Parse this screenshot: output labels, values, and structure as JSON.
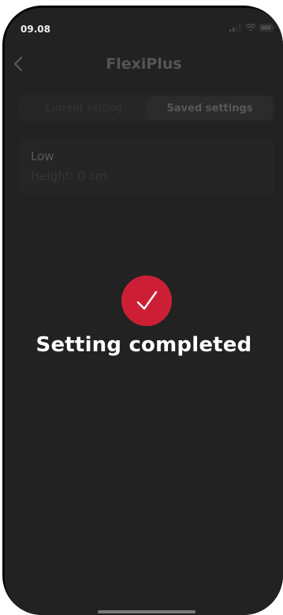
{
  "status_bar": {
    "time": "09.08",
    "icons": [
      "cellular-signal-icon",
      "wifi-icon",
      "battery-icon"
    ]
  },
  "nav": {
    "back_icon": "chevron-left-icon",
    "title": "FlexiPlus"
  },
  "tabs": [
    {
      "label": "Current setting",
      "selected": false
    },
    {
      "label": "Saved settings",
      "selected": true
    }
  ],
  "preset": {
    "name": "Low",
    "height": "Height: 0 cm"
  },
  "overlay": {
    "icon": "checkmark-icon",
    "message": "Setting completed"
  },
  "colors": {
    "accent": "#cc1f36",
    "background": "#222222",
    "overlay_text": "#ffffff"
  }
}
